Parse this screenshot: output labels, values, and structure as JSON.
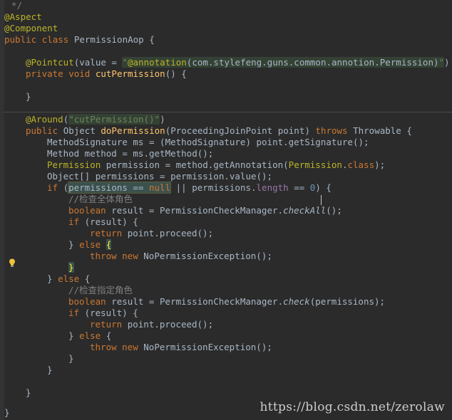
{
  "code": {
    "l0": "*/",
    "l1": "@Aspect",
    "l2": "@Component",
    "l3a": "public class ",
    "l3b": "PermissionAop {",
    "l5a": "@Pointcut",
    "l5b": "(value = ",
    "l5c": "\"",
    "l5d": "@annotation",
    "l5e": "(com.stylefeng.guns.common.annotion.Permission)",
    "l5f": "\"",
    "l5g": ")",
    "l6a": "private void ",
    "l6b": "cutPermission",
    "l6c": "() {",
    "l8": "}",
    "l10a": "@Around",
    "l10b": "(",
    "l10c": "\"cutPermission()\"",
    "l10d": ")",
    "l11a": "public ",
    "l11b": "Object ",
    "l11c": "doPermission",
    "l11d": "(ProceedingJoinPoint point) ",
    "l11e": "throws ",
    "l11f": "Throwable {",
    "l12": "MethodSignature ms = (MethodSignature) point.getSignature();",
    "l13": "Method method = ms.getMethod();",
    "l14a": "Permission ",
    "l14b": "permission = method.getAnnotation(",
    "l14c": "Permission",
    "l14d": ".",
    "l14e": "class",
    "l14f": ");",
    "l15": "Object[] permissions = permission.value();",
    "l16a": "if ",
    "l16b": "(",
    "l16c": "permissions == ",
    "l16d": "null",
    "l16e": " || permissions.",
    "l16f": "length",
    "l16g": " == ",
    "l16h": "0",
    "l16i": ") {",
    "l17": "//检查全体角色",
    "l18a": "boolean ",
    "l18b": "result = PermissionCheckManager.",
    "l18c": "checkAll",
    "l18d": "();",
    "l19a": "if ",
    "l19b": "(result) {",
    "l20a": "return ",
    "l20b": "point.proceed();",
    "l21a": "} ",
    "l21b": "else ",
    "l21c": "{",
    "l22a": "throw new ",
    "l22b": "NoPermissionException();",
    "l23": "}",
    "l24a": "} ",
    "l24b": "else ",
    "l24c": "{",
    "l25": "//检查指定角色",
    "l26a": "boolean ",
    "l26b": "result = PermissionCheckManager.",
    "l26c": "check",
    "l26d": "(permissions);",
    "l27a": "if ",
    "l27b": "(result) {",
    "l28a": "return ",
    "l28b": "point.proceed();",
    "l29a": "} ",
    "l29b": "else ",
    "l29c": "{",
    "l30a": "throw new ",
    "l30b": "NoPermissionException();",
    "l31": "}",
    "l32": "}",
    "l34": "}",
    "l36": "}"
  },
  "watermark": "https://blog.csdn.net/zerolaw",
  "icons": {
    "intention": "lightbulb-icon"
  },
  "colors": {
    "background": "#2b2b2b",
    "keyword": "#cc7832",
    "annotation": "#bbb529",
    "string": "#6a8759",
    "method": "#ffc66d",
    "comment": "#629755"
  }
}
